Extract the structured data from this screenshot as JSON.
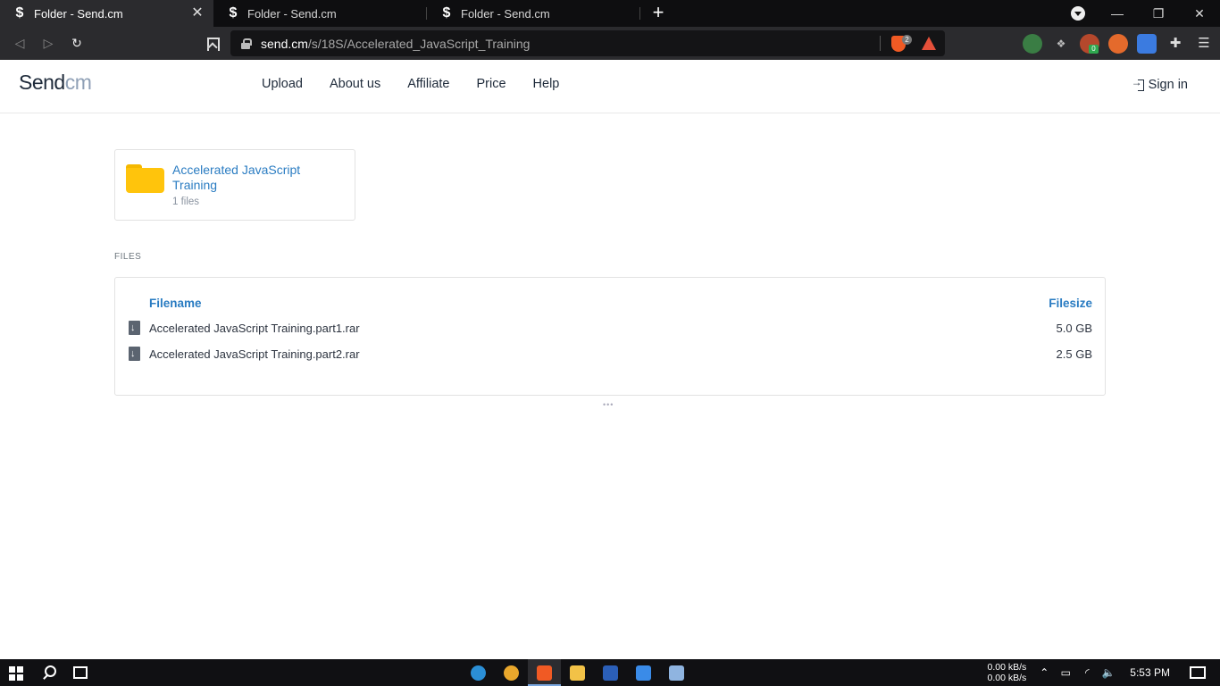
{
  "browser": {
    "tabs": [
      {
        "title": "Folder - Send.cm",
        "active": true
      },
      {
        "title": "Folder - Send.cm",
        "active": false
      },
      {
        "title": "Folder - Send.cm",
        "active": false
      }
    ],
    "favicon_glyph": "$",
    "close_glyph": "✕",
    "newtab_glyph": "+",
    "window_controls": {
      "minimize": "—",
      "restore": "❐",
      "close": "✕"
    },
    "nav": {
      "back": "◁",
      "forward": "▷",
      "reload": "↻"
    },
    "url": {
      "host": "send.cm",
      "path": "/s/18S/Accelerated_JavaScript_Training"
    },
    "shield_count": "2",
    "extensions": [
      {
        "icon": "vpn-globe-icon",
        "color": "#3a7d44"
      },
      {
        "icon": "paw-extension-icon",
        "color": "#2b2b2e"
      },
      {
        "icon": "ublock-icon",
        "color": "#b5482c",
        "badge": "0"
      },
      {
        "icon": "refresh-extension-icon",
        "color": "#e46a2c"
      },
      {
        "icon": "translate-icon",
        "color": "#3b7be0"
      },
      {
        "icon": "puzzle-extensions-icon",
        "color": "#2b2b2e"
      },
      {
        "icon": "menu-icon",
        "color": "#2b2b2e"
      }
    ],
    "extension_glyphs": {
      "puzzle": "✚",
      "menu": "☰"
    }
  },
  "site": {
    "logo_part1": "Send",
    "logo_part2": "cm",
    "nav": [
      "Upload",
      "About us",
      "Affiliate",
      "Price",
      "Help"
    ],
    "signin": "Sign in"
  },
  "folder": {
    "name": "Accelerated JavaScript Training",
    "count": "1 files"
  },
  "files": {
    "section_label": "FILES",
    "headers": {
      "name": "Filename",
      "size": "Filesize"
    },
    "rows": [
      {
        "name": "Accelerated JavaScript Training.part1.rar",
        "size": "5.0 GB"
      },
      {
        "name": "Accelerated JavaScript Training.part2.rar",
        "size": "2.5 GB"
      }
    ],
    "loader": "•••"
  },
  "taskbar": {
    "apps": [
      {
        "icon": "edge-icon",
        "color": "#2b8fd6"
      },
      {
        "icon": "chrome-icon",
        "color": "#e9a72c"
      },
      {
        "icon": "brave-icon",
        "color": "#f05a24",
        "active": true
      },
      {
        "icon": "file-explorer-icon",
        "color": "#f2c247"
      },
      {
        "icon": "word-icon",
        "color": "#2b5fb8"
      },
      {
        "icon": "todo-icon",
        "color": "#3a8be8"
      },
      {
        "icon": "notepad-icon",
        "color": "#8fb4e0"
      }
    ],
    "net_up": "0.00 kB/s",
    "net_down": "0.00 kB/s",
    "tray": {
      "chevron": "⌃",
      "battery": "▭",
      "wifi": "◜",
      "volume": "🔈"
    },
    "time": "5:53 PM"
  }
}
